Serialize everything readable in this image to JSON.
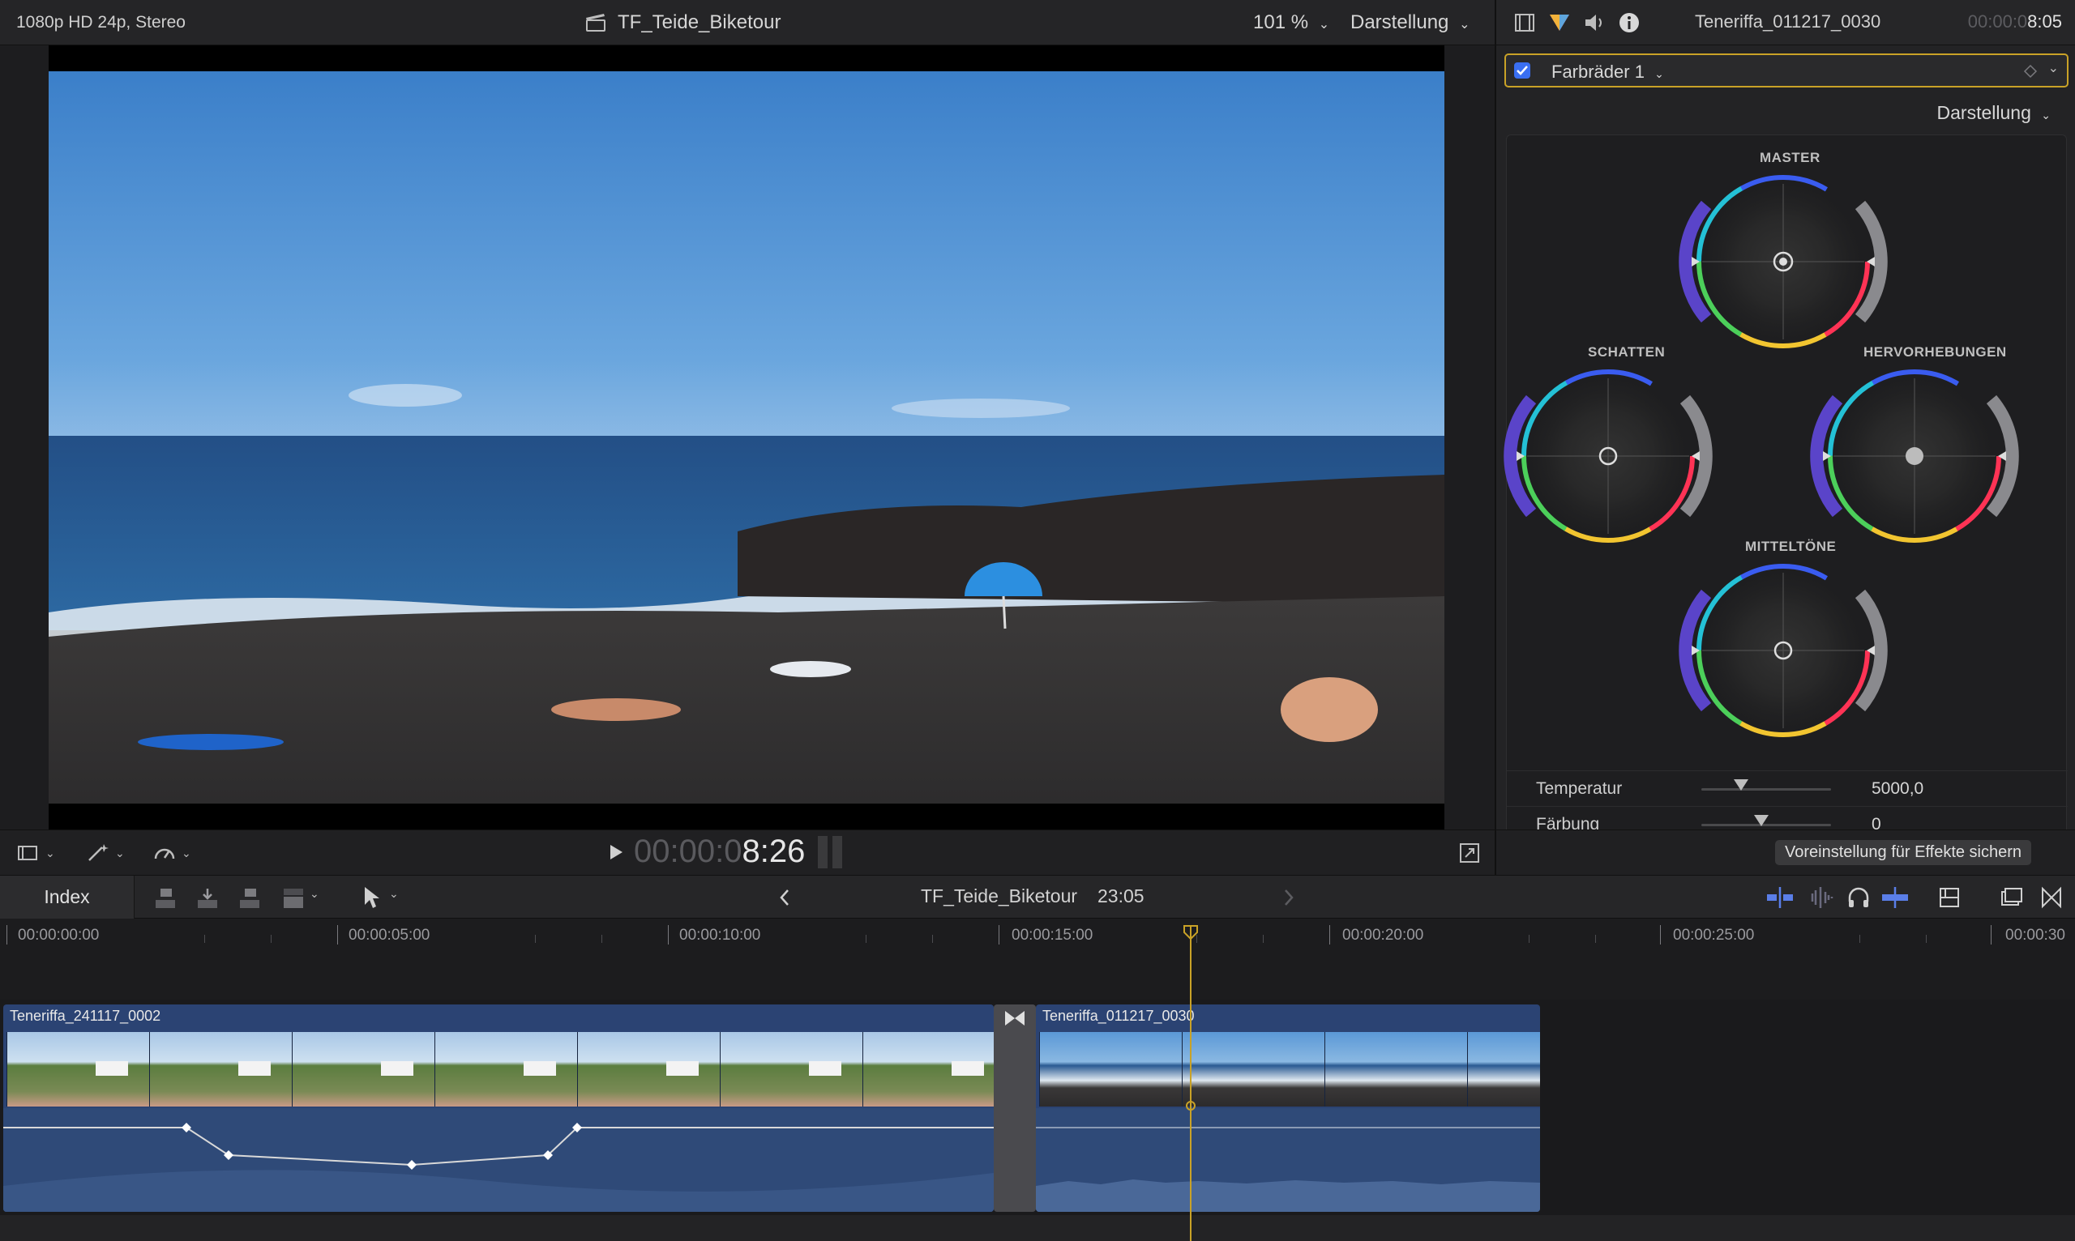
{
  "viewer": {
    "format": "1080p HD 24p, Stereo",
    "project_title": "TF_Teide_Biketour",
    "zoom": "101 %",
    "view_menu": "Darstellung",
    "timecode_dim": "00:00:0",
    "timecode_bright": "8:26"
  },
  "inspector": {
    "clip_name": "Teneriffa_011217_0030",
    "timecode_dim": "00:00:0",
    "timecode_bright": "8:05",
    "effect_name": "Farbräder 1",
    "view_menu": "Darstellung",
    "wheels": {
      "master": "MASTER",
      "shadows": "SCHATTEN",
      "highlights": "HERVORHEBUNGEN",
      "midtones": "MITTELTÖNE"
    },
    "params": [
      {
        "label": "Temperatur",
        "value": "5000,0"
      },
      {
        "label": "Färbung",
        "value": "0"
      }
    ],
    "save_preset": "Voreinstellung für Effekte sichern"
  },
  "timeline": {
    "index_label": "Index",
    "project_name": "TF_Teide_Biketour",
    "project_duration": "23:05",
    "ruler": [
      "00:00:00:00",
      "00:00:05:00",
      "00:00:10:00",
      "00:00:15:00",
      "00:00:20:00",
      "00:00:25:00",
      "00:00:30"
    ],
    "clips": [
      {
        "name": "Teneriffa_241117_0002"
      },
      {
        "name": "Teneriffa_011217_0030"
      }
    ]
  },
  "colors": {
    "accent": "#c9a227",
    "clip_blue": "#2b4373",
    "checkbox": "#3a6ff2"
  }
}
